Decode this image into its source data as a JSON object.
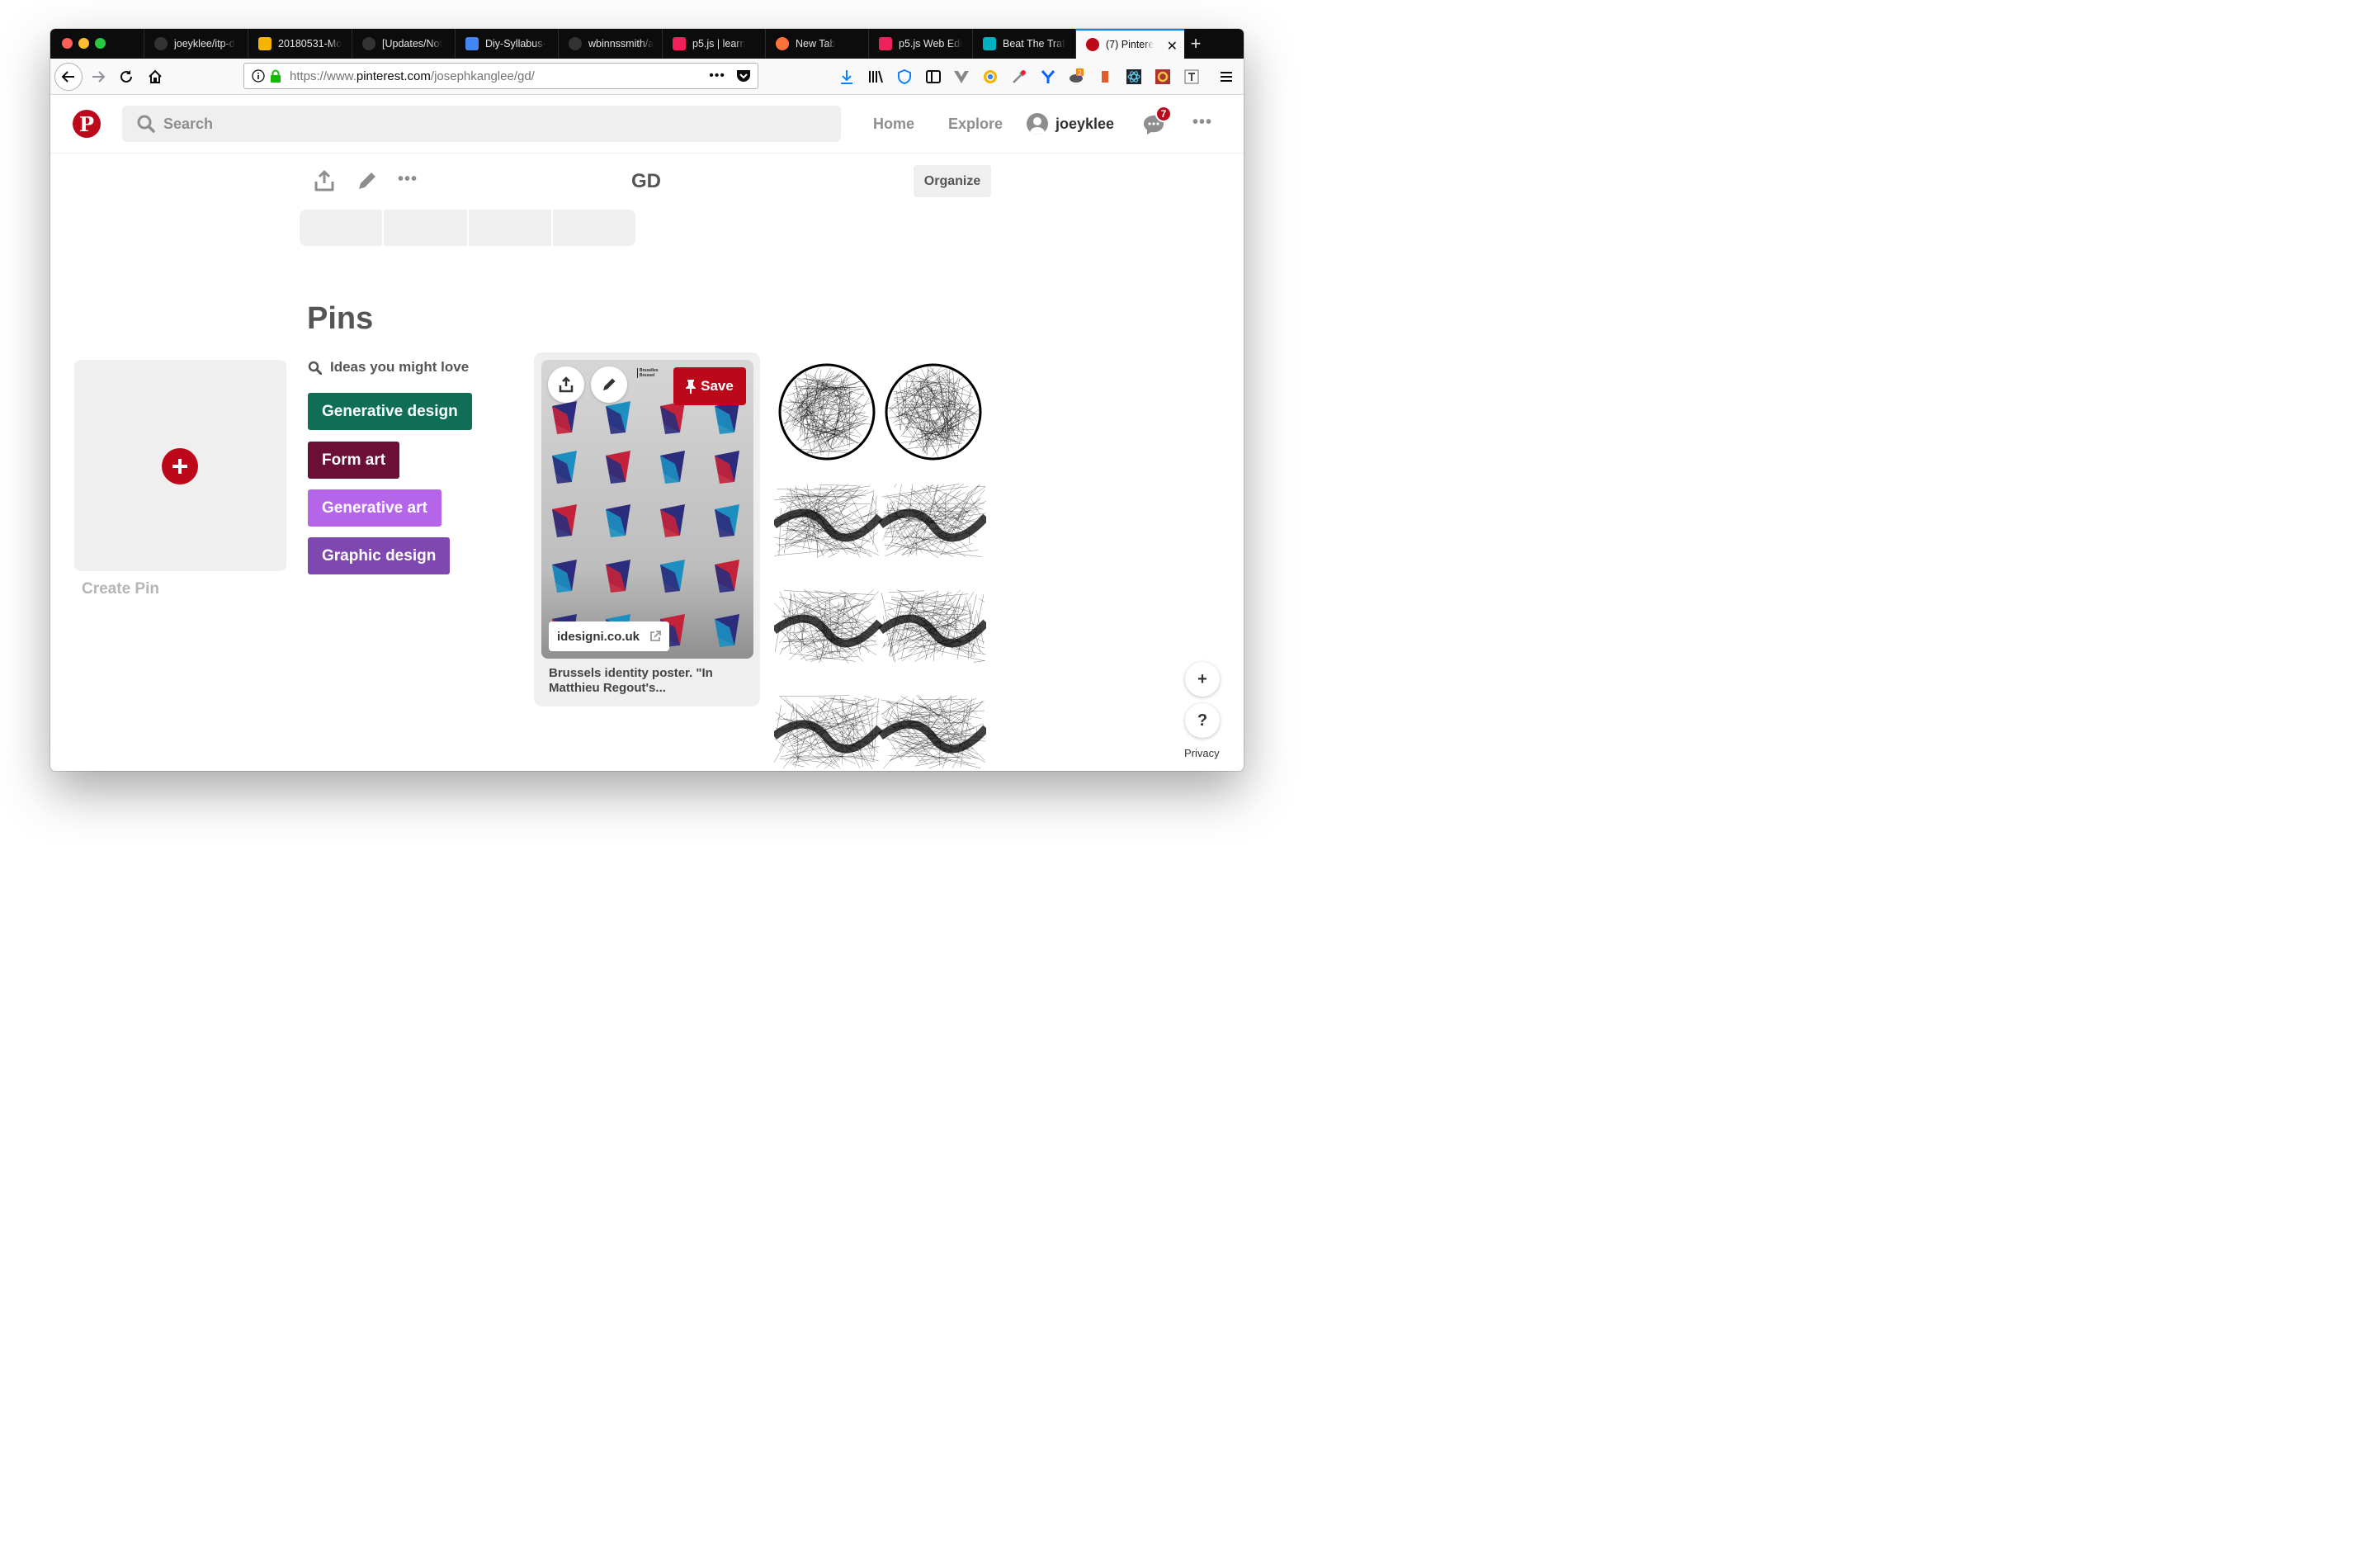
{
  "browser": {
    "tabs": [
      {
        "label": "joeyklee/itp-d",
        "icon": "github-icon",
        "color": "#333333"
      },
      {
        "label": "20180531-Mo",
        "icon": "slides-icon",
        "color": "#f4b400"
      },
      {
        "label": "[Updates/Not",
        "icon": "github-icon",
        "color": "#333333"
      },
      {
        "label": "Diy-Syllabus-",
        "icon": "docs-icon",
        "color": "#4285f4"
      },
      {
        "label": "wbinnssmith/a",
        "icon": "github-icon",
        "color": "#333333"
      },
      {
        "label": "p5.js | learn",
        "icon": "p5-icon",
        "color": "#ed225d"
      },
      {
        "label": "New Tab",
        "icon": "firefox-icon",
        "color": "#ff7139"
      },
      {
        "label": "p5.js Web Edi",
        "icon": "p5-icon",
        "color": "#ed225d"
      },
      {
        "label": "Beat The Traf",
        "icon": "beat-icon",
        "color": "#00b2c2"
      },
      {
        "label": "(7) Pintere",
        "icon": "pinterest-icon",
        "color": "#bd081c",
        "active": true
      }
    ],
    "new_tab": "+",
    "url_prefix": "https://www.",
    "url_domain": "pinterest.com",
    "url_path": "/josephkanglee/gd/",
    "url_more": "•••"
  },
  "header": {
    "logo": "P",
    "search_placeholder": "Search",
    "nav": [
      "Home",
      "Explore"
    ],
    "username": "joeyklee",
    "notifications": "7",
    "more": "•••"
  },
  "board": {
    "title": "GD",
    "organize": "Organize",
    "more": "•••"
  },
  "pins": {
    "title": "Pins",
    "create_label": "Create Pin",
    "ideas_label": "Ideas you might love",
    "chips": [
      {
        "label": "Generative design",
        "color": "#0f6e55"
      },
      {
        "label": "Form art",
        "color": "#6b0f37"
      },
      {
        "label": "Generative art",
        "color": "#b566e8"
      },
      {
        "label": "Graphic design",
        "color": "#7e48b0"
      }
    ],
    "card": {
      "save": "Save",
      "source": "idesigni.co.uk",
      "description": "Brussels identity poster. \"In Matthieu Regout's...",
      "poster_text_1": "Bruxelles",
      "poster_text_2": "Brussel"
    }
  },
  "floating": {
    "add": "+",
    "help": "?",
    "privacy": "Privacy"
  }
}
